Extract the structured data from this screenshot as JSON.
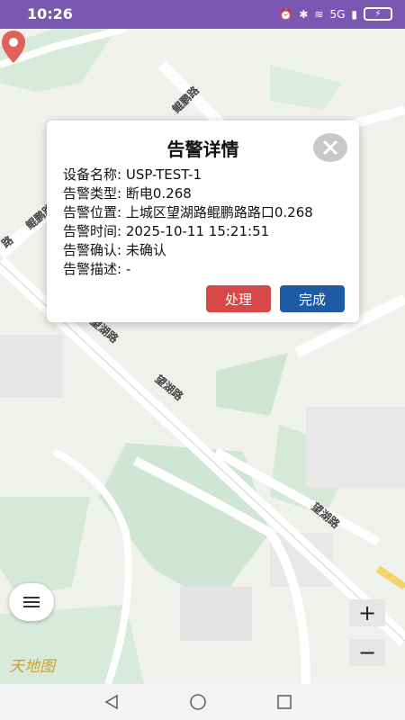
{
  "status_bar": {
    "time": "10:26",
    "signal_label": "5G",
    "battery_icon": "battery-charging-icon"
  },
  "map": {
    "road_labels": [
      "鲲鹏路",
      "鲲鹏路",
      "路",
      "望湖路",
      "望湖路",
      "望湖路"
    ],
    "logo_text": "天地图",
    "zoom_in_label": "+",
    "zoom_out_label": "−"
  },
  "dialog": {
    "title": "告警详情",
    "fields": [
      {
        "label": "设备名称:",
        "value": "USP-TEST-1"
      },
      {
        "label": "告警类型:",
        "value": "断电0.268"
      },
      {
        "label": "告警位置:",
        "value": "上城区望湖路鲲鹏路路口0.268"
      },
      {
        "label": "告警时间:",
        "value": "2025-10-11 15:21:51"
      },
      {
        "label": "告警确认:",
        "value": "未确认"
      },
      {
        "label": "告警描述:",
        "value": "-"
      }
    ],
    "handle_label": "处理",
    "done_label": "完成"
  },
  "colors": {
    "status_bar": "#7a57b1",
    "handle_button": "#d84848",
    "done_button": "#1f5aa6",
    "marker": "#e0605a"
  }
}
